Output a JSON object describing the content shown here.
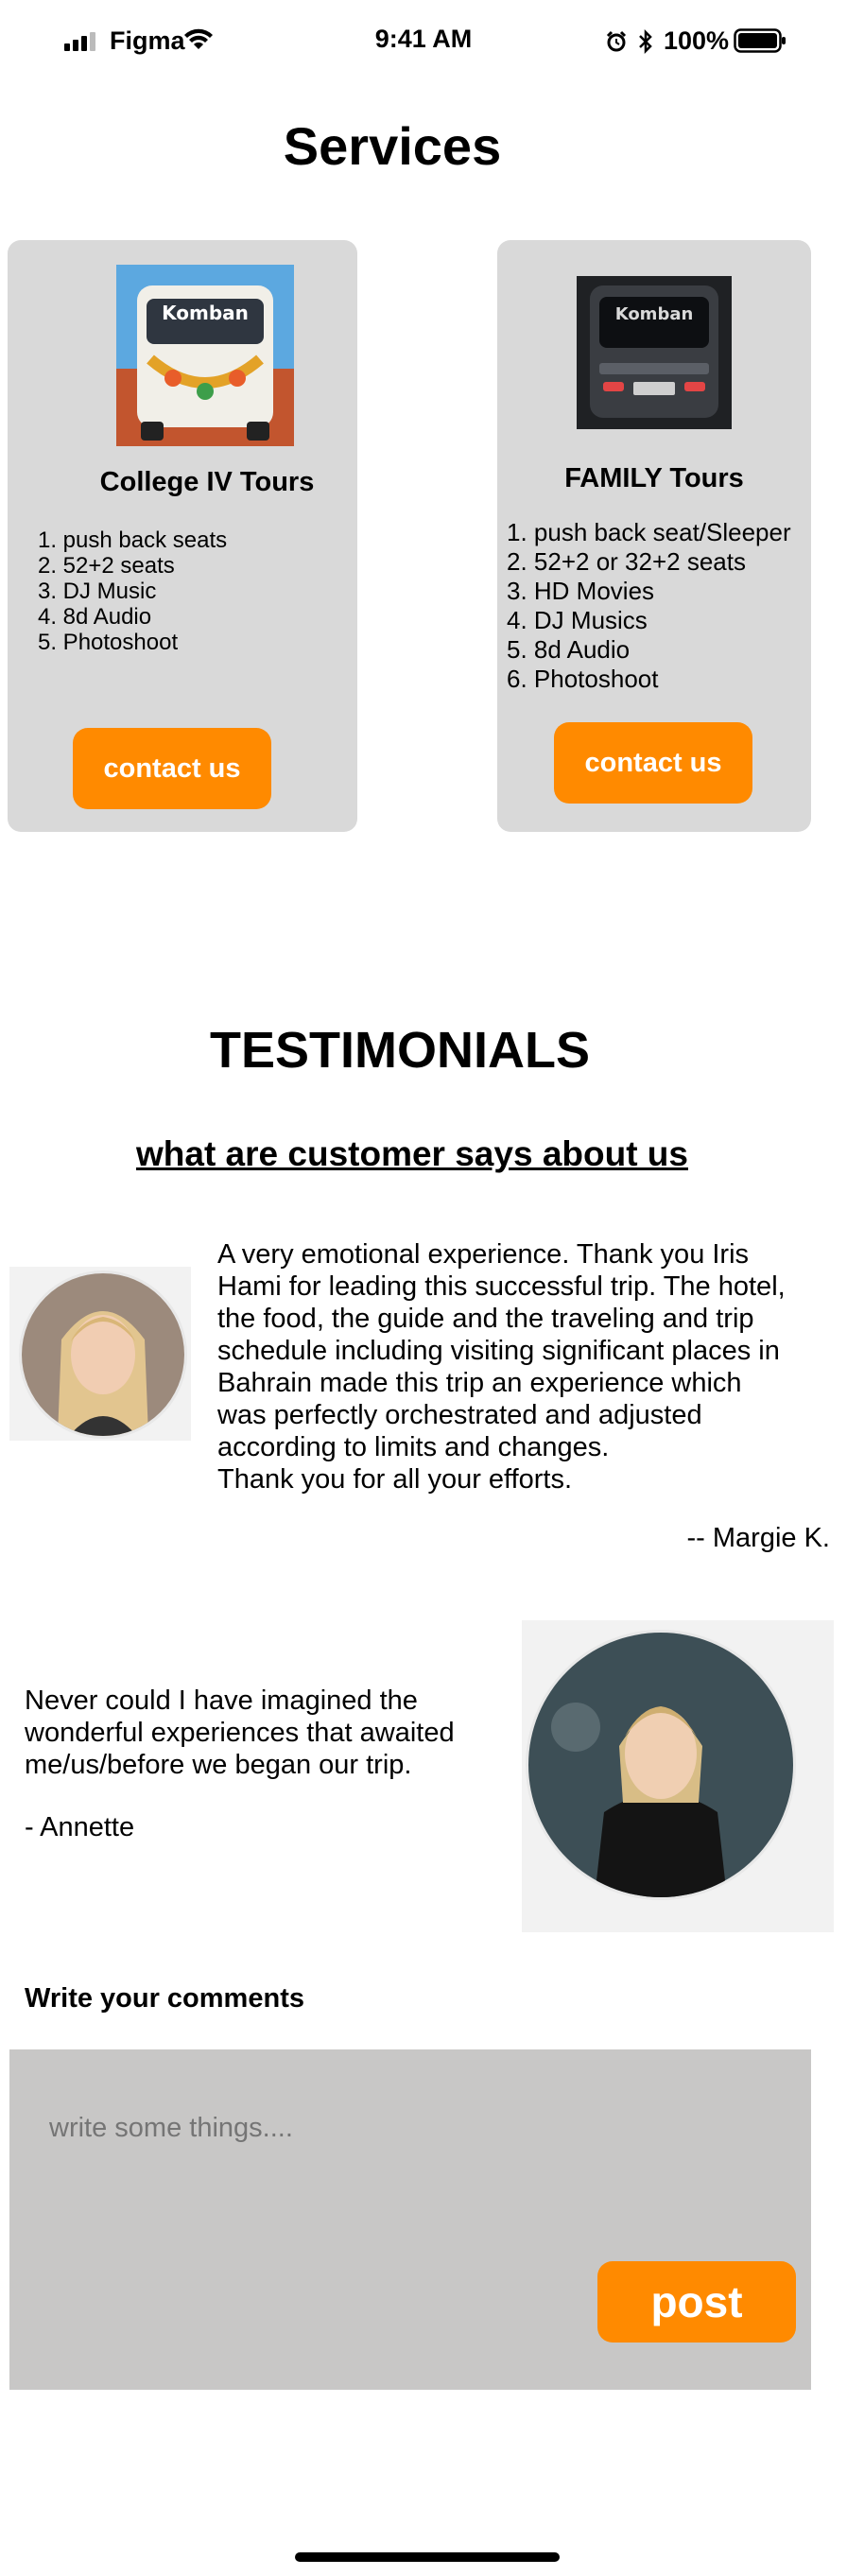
{
  "status_bar": {
    "carrier": "Figma",
    "time": "9:41 AM",
    "battery": "100%",
    "icons": [
      "signal-icon",
      "wifi-icon",
      "alarm-icon",
      "bluetooth-icon",
      "battery-icon"
    ]
  },
  "services": {
    "title": "Services",
    "cards": [
      {
        "title": "College IV Tours",
        "features": [
          "1. push back seats",
          "2. 52+2 seats",
          "3.  DJ Music",
          "4. 8d Audio",
          "5. Photoshoot"
        ],
        "button": "contact us"
      },
      {
        "title": "FAMILY Tours",
        "features": [
          "1. push back seat/Sleeper",
          "2. 52+2 or 32+2 seats",
          "3. HD Movies",
          "4. DJ Musics",
          "5. 8d Audio",
          "6. Photoshoot"
        ],
        "button": "contact us"
      }
    ],
    "bus_logo_text": "Komban"
  },
  "testimonials": {
    "title": "TESTIMONIALS",
    "subtitle": "what are customer says about us",
    "items": [
      {
        "text_lines": [
          "A very emotional experience. Thank you Iris",
          "Hami for leading this successful trip. The hotel,",
          "the food, the guide and the traveling and trip",
          "schedule including visiting significant places in",
          "Bahrain made this trip an experience which",
          "was perfectly orchestrated and adjusted",
          "according to limits and changes.",
          "Thank you for all your efforts."
        ],
        "author": "-- Margie K."
      },
      {
        "text_lines": [
          "Never could I have imagined the",
          "wonderful experiences that awaited",
          "me/us/before we began our trip."
        ],
        "author": "- Annette"
      }
    ]
  },
  "comments": {
    "label": "Write your comments",
    "placeholder": "write some things....",
    "post_button": "post"
  },
  "colors": {
    "accent": "#ff8a00",
    "card_bg": "#d9d9d9",
    "comment_bg": "#c8c7c6"
  }
}
